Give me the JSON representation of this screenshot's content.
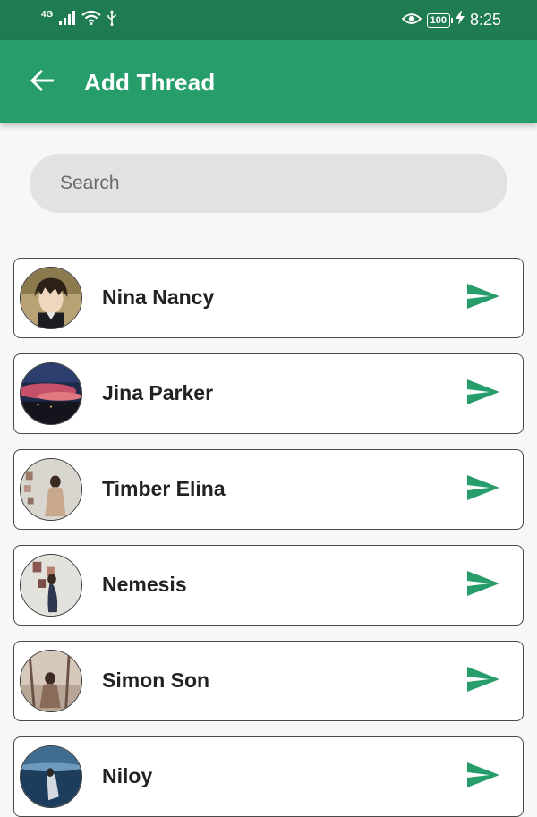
{
  "status_bar": {
    "network_label": "4G",
    "battery_level": "100",
    "time": "8:25",
    "icons": [
      "signal-icon",
      "wifi-icon",
      "usb-icon",
      "eye-icon",
      "battery-icon",
      "charging-icon"
    ]
  },
  "app_bar": {
    "title": "Add Thread",
    "back_icon": "arrow-left-icon",
    "color": "#279d6c"
  },
  "search": {
    "placeholder": "Search",
    "value": ""
  },
  "contacts": [
    {
      "name": "Nina Nancy",
      "avatar": "anime-boy-avatar"
    },
    {
      "name": "Jina Parker",
      "avatar": "sunset-sky-avatar"
    },
    {
      "name": "Timber Elina",
      "avatar": "girl-paper-wall-avatar"
    },
    {
      "name": "Nemesis",
      "avatar": "woman-art-avatar"
    },
    {
      "name": "Simon Son",
      "avatar": "girl-trees-avatar"
    },
    {
      "name": "Niloy",
      "avatar": "blue-water-avatar"
    }
  ],
  "colors": {
    "status_bar": "#1f7b52",
    "accent": "#279d6c",
    "send_icon": "#279d6c"
  }
}
